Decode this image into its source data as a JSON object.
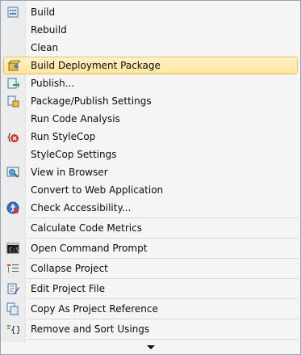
{
  "menu": {
    "items": [
      {
        "label": "Build",
        "icon": "build-icon"
      },
      {
        "label": "Rebuild"
      },
      {
        "label": "Clean"
      },
      {
        "label": "Build Deployment Package",
        "icon": "deployment-package-icon",
        "highlighted": true
      },
      {
        "label": "Publish...",
        "icon": "publish-icon"
      },
      {
        "label": "Package/Publish Settings",
        "icon": "package-settings-icon"
      },
      {
        "label": "Run Code Analysis"
      },
      {
        "label": "Run StyleCop",
        "icon": "stylecop-icon"
      },
      {
        "label": "StyleCop Settings"
      },
      {
        "label": "View in Browser",
        "icon": "browser-icon"
      },
      {
        "label": "Convert to Web Application"
      },
      {
        "label": "Check Accessibility...",
        "icon": "accessibility-icon"
      },
      {
        "label": "Calculate Code Metrics"
      },
      {
        "label": "Open Command Prompt",
        "icon": "command-prompt-icon"
      },
      {
        "label": "Collapse Project",
        "icon": "collapse-project-icon"
      },
      {
        "label": "Edit Project File",
        "icon": "edit-file-icon"
      },
      {
        "label": "Copy As Project Reference",
        "icon": "copy-reference-icon"
      },
      {
        "label": "Remove and Sort Usings",
        "icon": "sort-usings-icon"
      }
    ],
    "scroll_more_icon": "chevron-down-icon"
  }
}
